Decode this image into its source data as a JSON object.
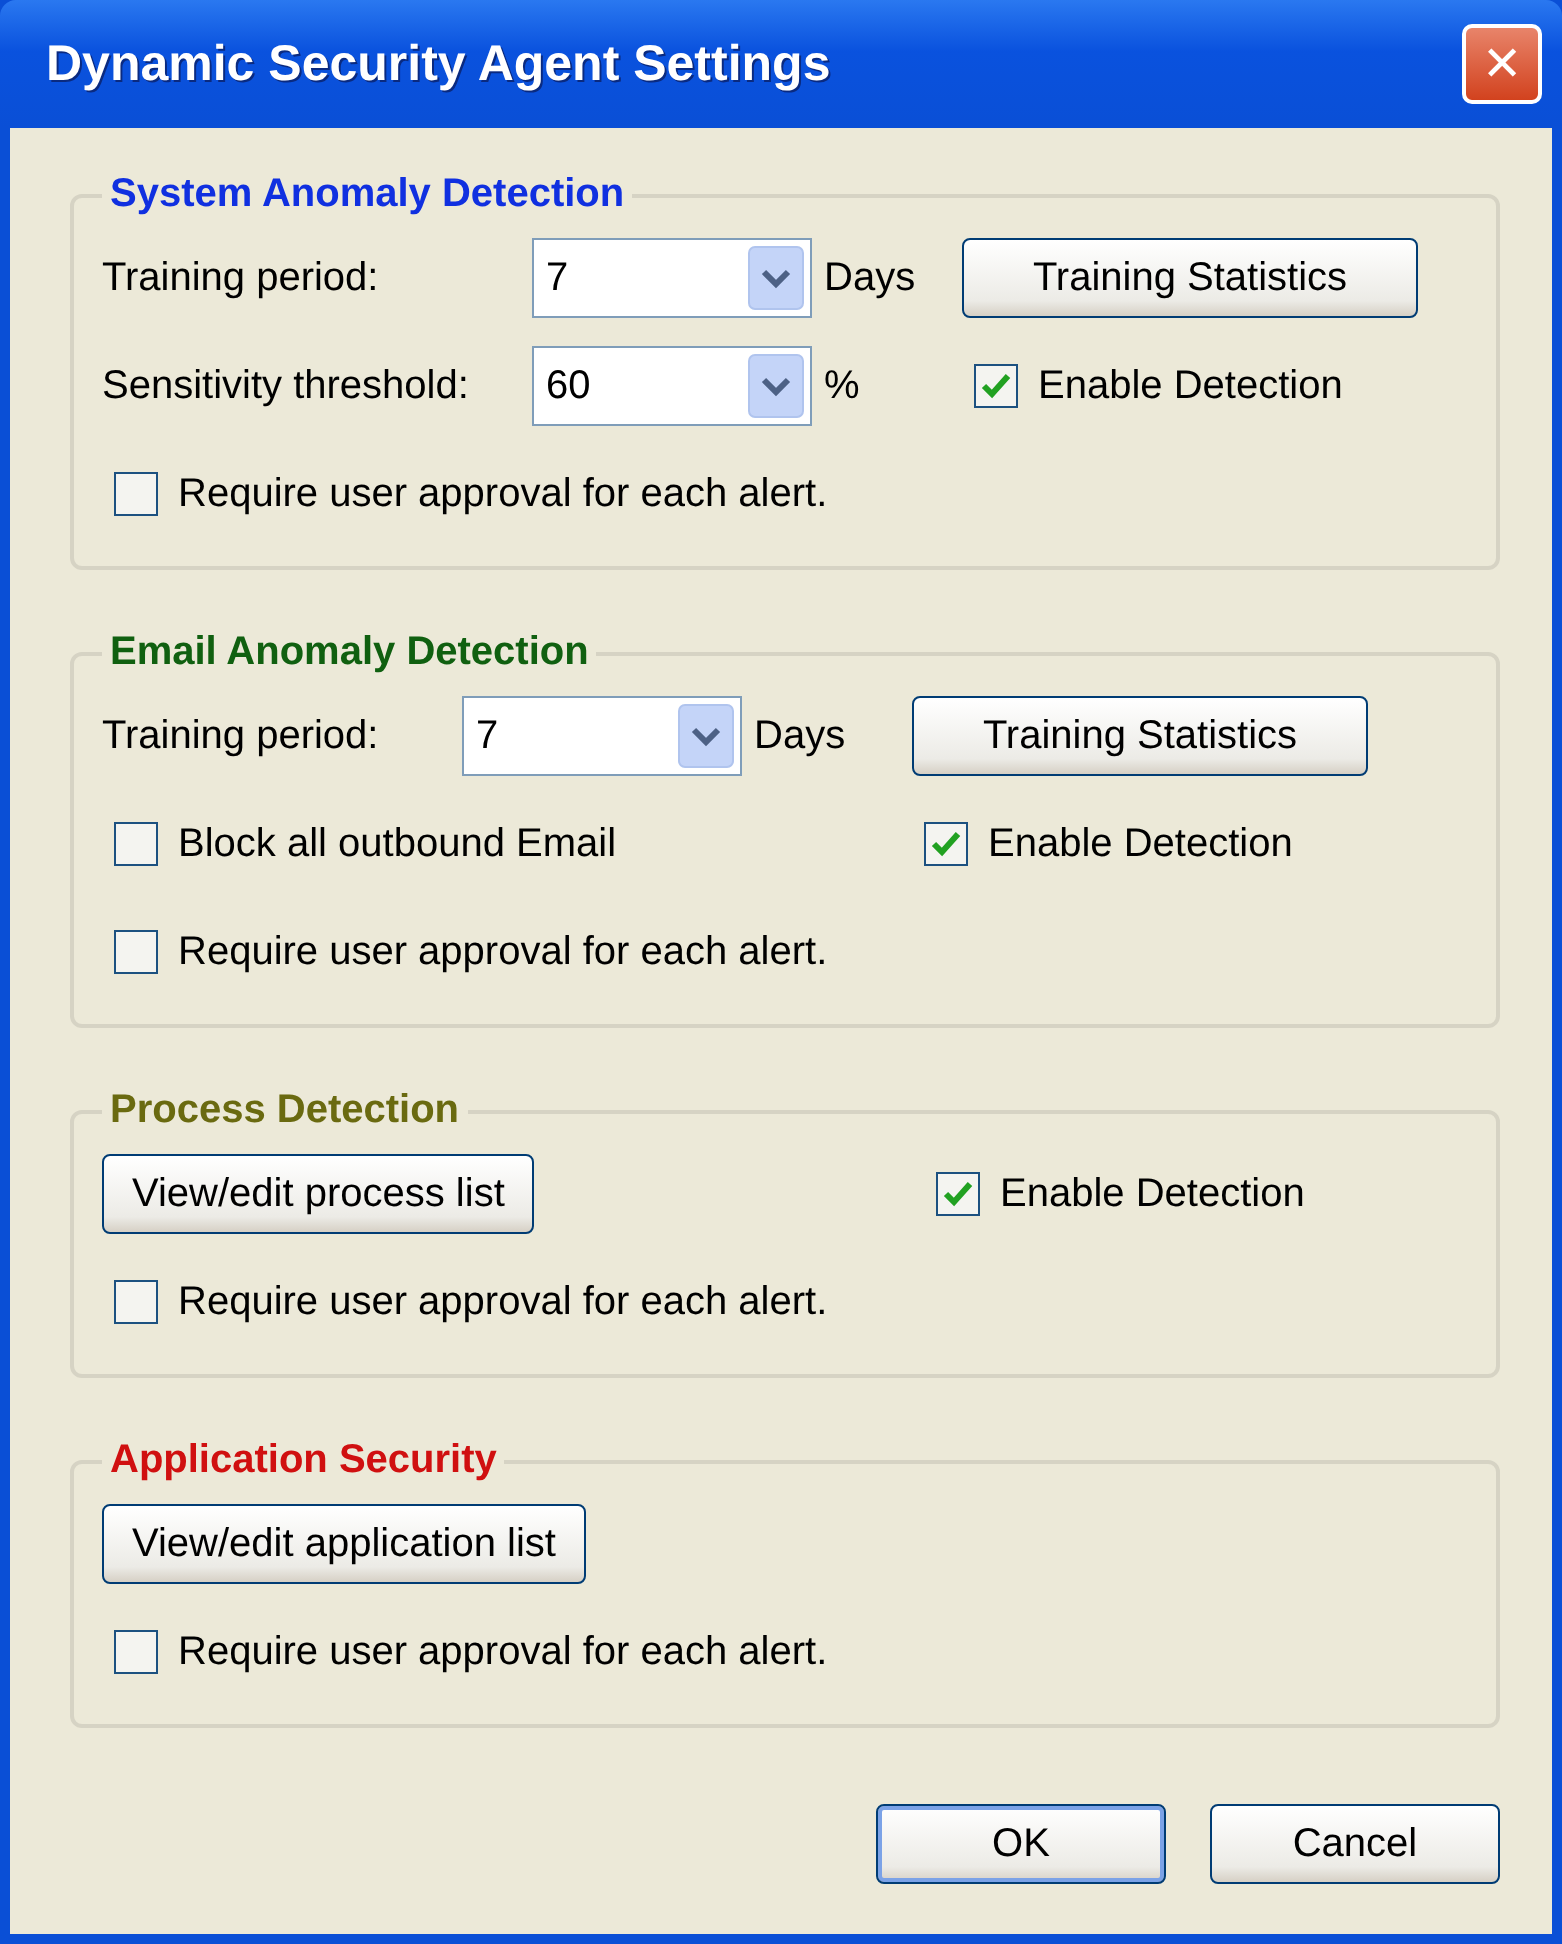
{
  "window": {
    "title": "Dynamic Security Agent Settings",
    "close": "✕"
  },
  "groups": [
    {
      "title": "System Anomaly Detection",
      "color": "#1030e0",
      "fields": [
        {
          "label": "Training period:",
          "value": "7",
          "unit": "Days"
        },
        {
          "label": "Sensitivity threshold:",
          "value": "60",
          "unit": "%"
        }
      ],
      "button": "Training Statistics",
      "enable": {
        "text": "Enable Detection",
        "checked": true
      },
      "options": [
        {
          "text": "Require user approval for each alert.",
          "checked": false
        }
      ]
    },
    {
      "title": "Email Anomaly Detection",
      "color": "#106010",
      "fields": [
        {
          "label": "Training period:",
          "value": "7",
          "unit": "Days"
        }
      ],
      "button": "Training Statistics",
      "enable": {
        "text": "Enable Detection",
        "checked": true
      },
      "options": [
        {
          "text": "Block all outbound Email",
          "checked": false
        },
        {
          "text": "Require user approval for each alert.",
          "checked": false
        }
      ]
    },
    {
      "title": "Process Detection",
      "color": "#6a6a10",
      "button": "View/edit process list",
      "enable": {
        "text": "Enable Detection",
        "checked": true
      },
      "options": [
        {
          "text": "Require user approval for each alert.",
          "checked": false
        }
      ]
    },
    {
      "title": "Application Security",
      "color": "#d01010",
      "button": "View/edit application list",
      "options": [
        {
          "text": "Require user approval for each alert.",
          "checked": false
        }
      ]
    }
  ],
  "buttons": [
    {
      "text": "OK",
      "default": true
    },
    {
      "text": "Cancel",
      "default": false
    }
  ]
}
